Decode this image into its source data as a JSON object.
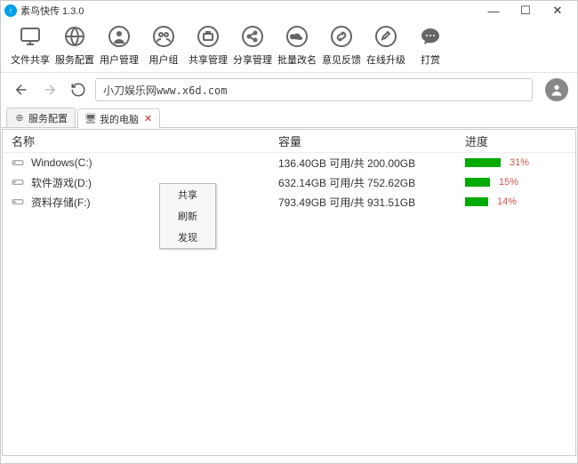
{
  "window": {
    "title": "素鸟快传 1.3.0",
    "min": "—",
    "max": "☐",
    "close": "✕"
  },
  "toolbar": [
    {
      "label": "文件共享"
    },
    {
      "label": "服务配置"
    },
    {
      "label": "用户管理"
    },
    {
      "label": "用户组"
    },
    {
      "label": "共享管理"
    },
    {
      "label": "分享管理"
    },
    {
      "label": "批量改名"
    },
    {
      "label": "意见反馈"
    },
    {
      "label": "在线升级"
    },
    {
      "label": "打赏"
    }
  ],
  "address": "小刀娱乐网www.x6d.com",
  "tabs": [
    {
      "label": "服务配置",
      "active": false,
      "closable": false
    },
    {
      "label": "我的电脑",
      "active": true,
      "closable": true
    }
  ],
  "columns": {
    "name": "名称",
    "cap": "容量",
    "prog": "进度"
  },
  "drives": [
    {
      "name": "Windows(C:)",
      "cap": "136.40GB 可用/共 200.00GB",
      "pct": "31%"
    },
    {
      "name": "软件游戏(D:)",
      "cap": "632.14GB 可用/共 752.62GB",
      "pct": "15%"
    },
    {
      "name": "资料存储(F:)",
      "cap": "793.49GB 可用/共 931.51GB",
      "pct": "14%"
    }
  ],
  "context_menu": [
    "共享",
    "刷新",
    "发现"
  ]
}
